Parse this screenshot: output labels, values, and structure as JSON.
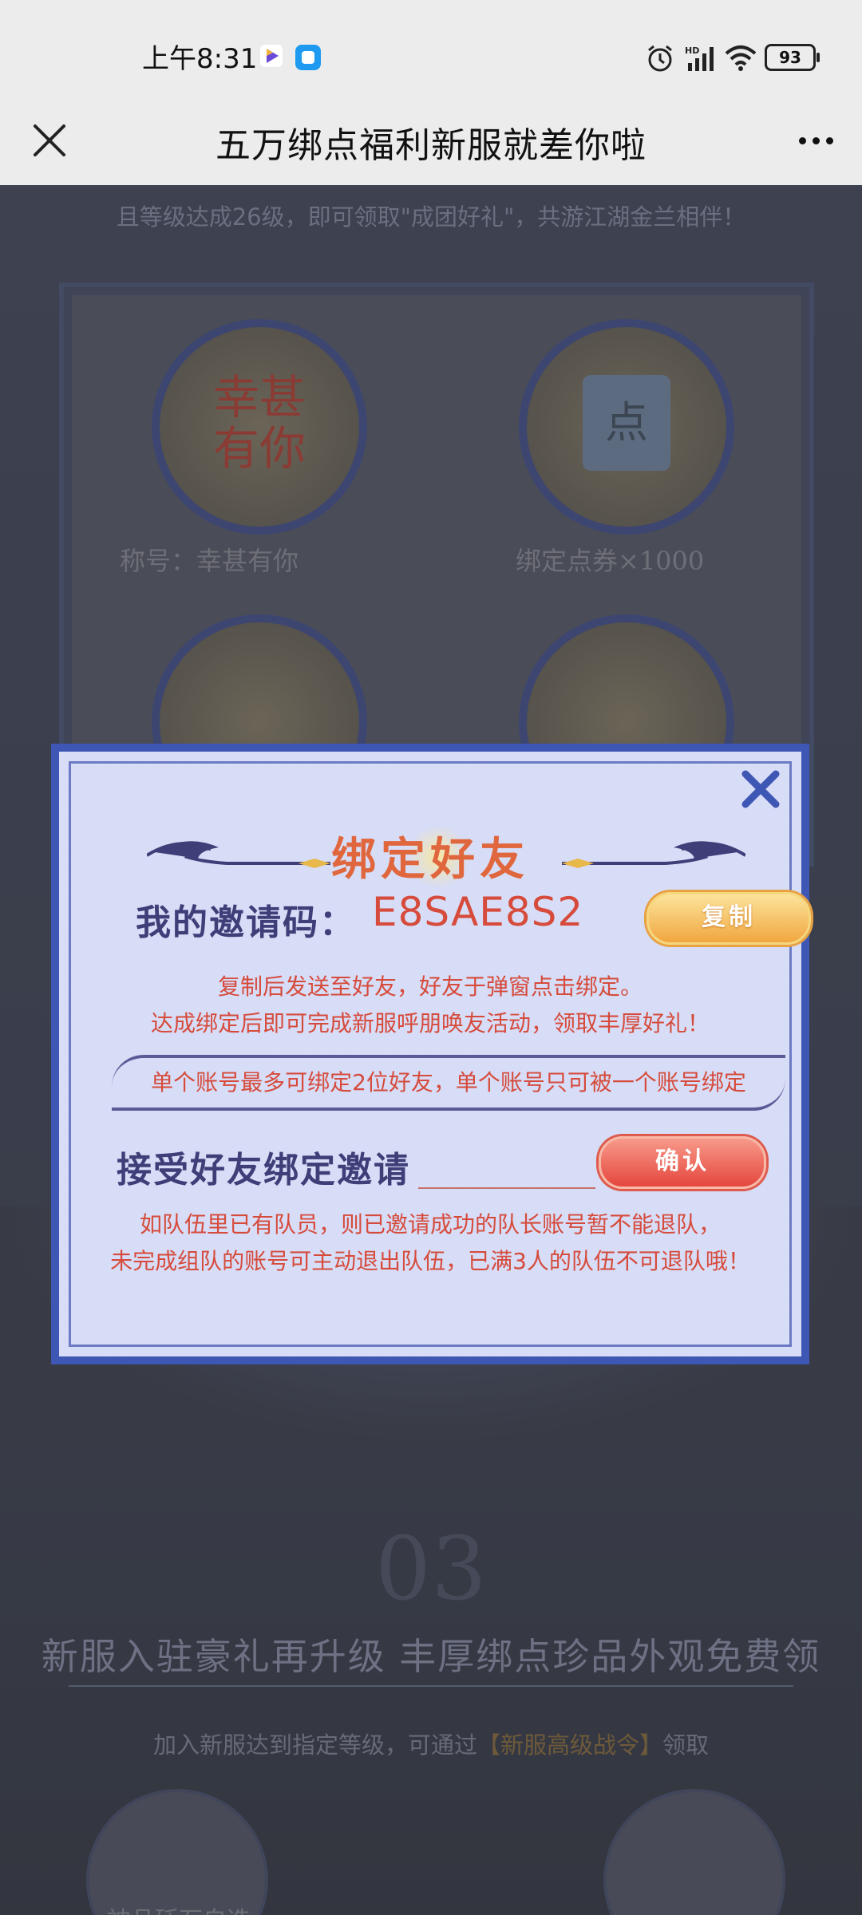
{
  "status_bar": {
    "time": "上午8:31",
    "battery": "93",
    "icons": [
      "video-app-icon",
      "chat-app-icon",
      "alarm-icon",
      "hd-signal-icon",
      "wifi-icon",
      "battery-icon"
    ]
  },
  "title_bar": {
    "title": "五万绑点福利新服就差你啦",
    "close_icon": "close-icon",
    "more_icon": "more-icon"
  },
  "background_page": {
    "description": "且等级达成26级，即可领取\"成团好礼\"，共游江湖金兰相伴！",
    "rewards": [
      {
        "label": "称号：幸甚有你",
        "badge": "幸甚有你"
      },
      {
        "label": "绑定点券×1000",
        "badge": "点"
      }
    ],
    "section_number": "03",
    "section_headline": "新服入驻豪礼再升级 丰厚绑点珍品外观免费领",
    "section_sub_prefix": "加入新服达到指定等级，可通过",
    "section_sub_highlight": "【新服高级战令】",
    "section_sub_suffix": "领取",
    "bottom_item": "神品砭石自选"
  },
  "modal": {
    "title": "绑定好友",
    "invite_label": "我的邀请码：",
    "invite_code": "E8SAE8S2",
    "copy_button": "复制",
    "desc_line1": "复制后发送至好友，好友于弹窗点击绑定。",
    "desc_line2": "达成绑定后即可完成新服呼朋唤友活动，领取丰厚好礼！",
    "rule": "单个账号最多可绑定2位好友，单个账号只可被一个账号绑定",
    "accept_label": "接受好友绑定邀请",
    "accept_input_value": "",
    "confirm_button": "确认",
    "note_line1": "如队伍里已有队员，则已邀请成功的队长账号暂不能退队，",
    "note_line2": "未完成组队的账号可主动退出队伍，已满3人的队伍不可退队哦！",
    "accent_color": "#d64b3b",
    "frame_color": "#3e56b4"
  }
}
